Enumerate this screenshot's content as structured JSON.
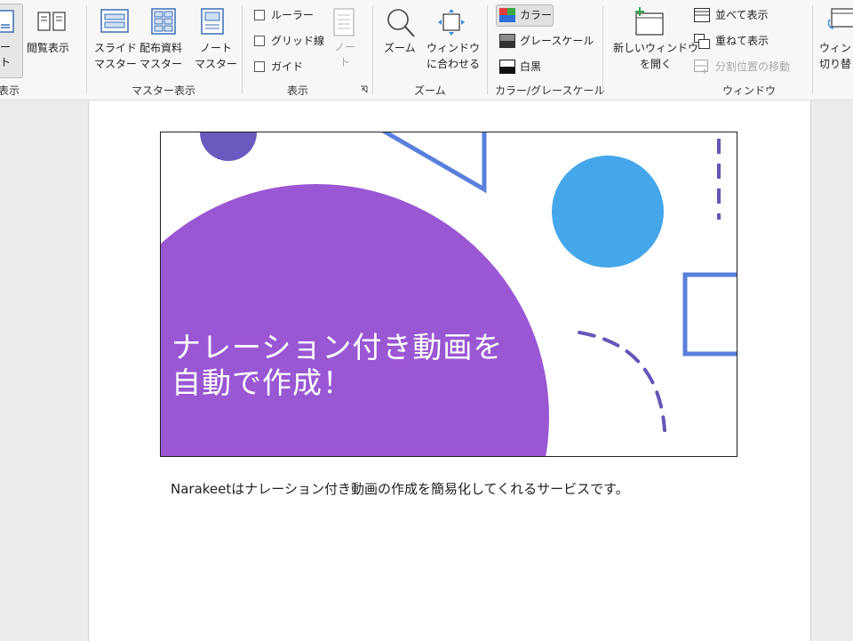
{
  "ribbon": {
    "views": {
      "note_partial": "ー\nト",
      "reading": "閲覧表示",
      "group_partial": "表示"
    },
    "master": {
      "slide_master": "スライド\nマスター",
      "handout_master": "配布資料\nマスター",
      "notes_master": "ノート\nマスター",
      "group": "マスター表示"
    },
    "show": {
      "ruler": "ルーラー",
      "gridlines": "グリッド線",
      "guides": "ガイド",
      "notes": "ノー\nト",
      "group": "表示"
    },
    "zoom": {
      "zoom": "ズーム",
      "fit_window": "ウィンドウ\nに合わせる",
      "group": "ズーム"
    },
    "color": {
      "color": "カラー",
      "grayscale": "グレースケール",
      "black_white": "白黒",
      "group": "カラー/グレースケール"
    },
    "window": {
      "new_window": "新しいウィンドウ\nを開く",
      "arrange_all": "並べて表示",
      "cascade": "重ねて表示",
      "move_split": "分割位置の移動",
      "switch_windows": "ウィンド\n切り替え",
      "group": "ウィンドウ"
    }
  },
  "slide": {
    "title": "ナレーション付き動画を\n自動で作成！"
  },
  "notes_text": "Narakeetはナレーション付き動画の作成を簡易化してくれるサービスです。",
  "colors": {
    "purple": "#9a57d4",
    "indigo": "#6a5abf",
    "blue": "#45a6ea",
    "stroke_blue": "#5a7fdc",
    "dash_purple": "#6755b8"
  }
}
